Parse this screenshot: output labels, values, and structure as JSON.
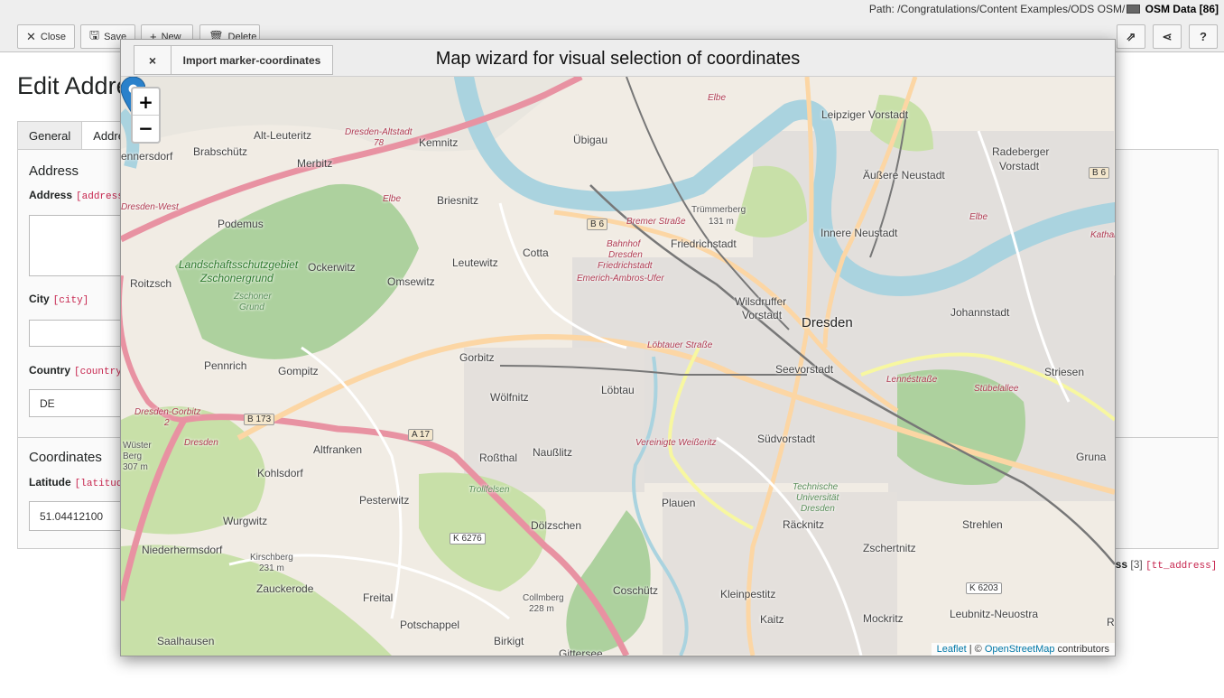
{
  "path": {
    "label": "Path: /Congratulations/Content Examples/ODS OSM/",
    "page": "OSM Data [86]"
  },
  "toolbar": {
    "close": "Close",
    "save": "Save",
    "new": "New",
    "delete": "Delete"
  },
  "form": {
    "title": "Edit Address",
    "tabs": [
      "General",
      "Address"
    ],
    "section_address": "Address",
    "address_label": "Address",
    "address_field": "[address]",
    "city_label": "City",
    "city_field": "[city]",
    "country_label": "Country",
    "country_field": "[country]",
    "country_value": "DE",
    "section_coordinates": "Coordinates",
    "latitude_label": "Latitude",
    "latitude_field": "[latitude]",
    "latitude_value": "51.04412100",
    "footer_table": "ess",
    "footer_count": "[3]",
    "footer_code": "[tt_address]"
  },
  "modal": {
    "close_icon": "×",
    "import_button": "Import marker-coordinates",
    "title": "Map wizard for visual selection of coordinates",
    "zoom_in": "+",
    "zoom_out": "−",
    "attribution": {
      "leaflet": "Leaflet",
      "sep": " | © ",
      "osm": "OpenStreetMap",
      "suffix": " contributors"
    }
  },
  "map_labels": [
    "Leipziger Vorstadt",
    "Radeberger",
    "Vorstadt",
    "Äußere Neustadt",
    "Innere Neustadt",
    "Friedrichstadt",
    "Wilsdruffer",
    "Vorstadt",
    "Dresden",
    "Johannstadt",
    "Seevorstadt",
    "Striesen",
    "Löbtau",
    "Gorbitz",
    "Cotta",
    "Leutewitz",
    "Briesnitz",
    "Omsewitz",
    "Ockerwitz",
    "Podemus",
    "Merbitz",
    "Brabschütz",
    "Alt-Leuteritz",
    "Kemnitz",
    "Übigau",
    "Roitzsch",
    "Pennrich",
    "Gompitz",
    "Wölfnitz",
    "Altfranken",
    "Naußlitz",
    "Roßthal",
    "Südvorstadt",
    "Plauen",
    "Räcknitz",
    "Zschertnitz",
    "Gruna",
    "Strehlen",
    "Kohlsdorf",
    "Pesterwitz",
    "Wurgwitz",
    "Dölzschen",
    "Niederhermsdorf",
    "Zauckerode",
    "Freital",
    "Potschappel",
    "Coschütz",
    "Kleinpestitz",
    "Mockritz",
    "Kaitz",
    "Saalhausen",
    "Birkigt",
    "Gittersee",
    "Leubnitz-Neuostra",
    "ennersdorf",
    "Trümmerberg",
    "131 m",
    "Wüster",
    "Berg",
    "307 m",
    "Kirschberg",
    "231 m",
    "Collmberg",
    "228 m",
    "Landschaftsschutzgebiet",
    "Zschonergrund",
    "Zschoner",
    "Grund",
    "Bahnhof",
    "Dresden",
    "Friedrichstadt",
    "Technische",
    "Universität",
    "Dresden",
    "Trollfelsen",
    "R"
  ],
  "map_shields": [
    "B 6",
    "B 6",
    "B 173",
    "A 17",
    "K 6276",
    "K 6203"
  ],
  "map_roads": [
    "Dresden-Altstadt",
    "78",
    "Dresden-West",
    "Dresden-Gorbitz",
    "2",
    "Dresden",
    "Bremer Straße",
    "Emerich-Ambros-Ufer",
    "Löbtauer Straße",
    "Stübelallee",
    "Lennéstraße",
    "Vereinigte Weißeritz",
    "Elbe",
    "Elbe",
    "Elbe",
    "Katharinenstraße"
  ],
  "colors": {
    "water": "#aad3df",
    "park": "#c8e0a8",
    "forest": "#add19e",
    "residential": "#e0dfdf",
    "primary_road": "#e892a2",
    "secondary_road": "#fcd6a4",
    "marker": "#2a81cb"
  }
}
